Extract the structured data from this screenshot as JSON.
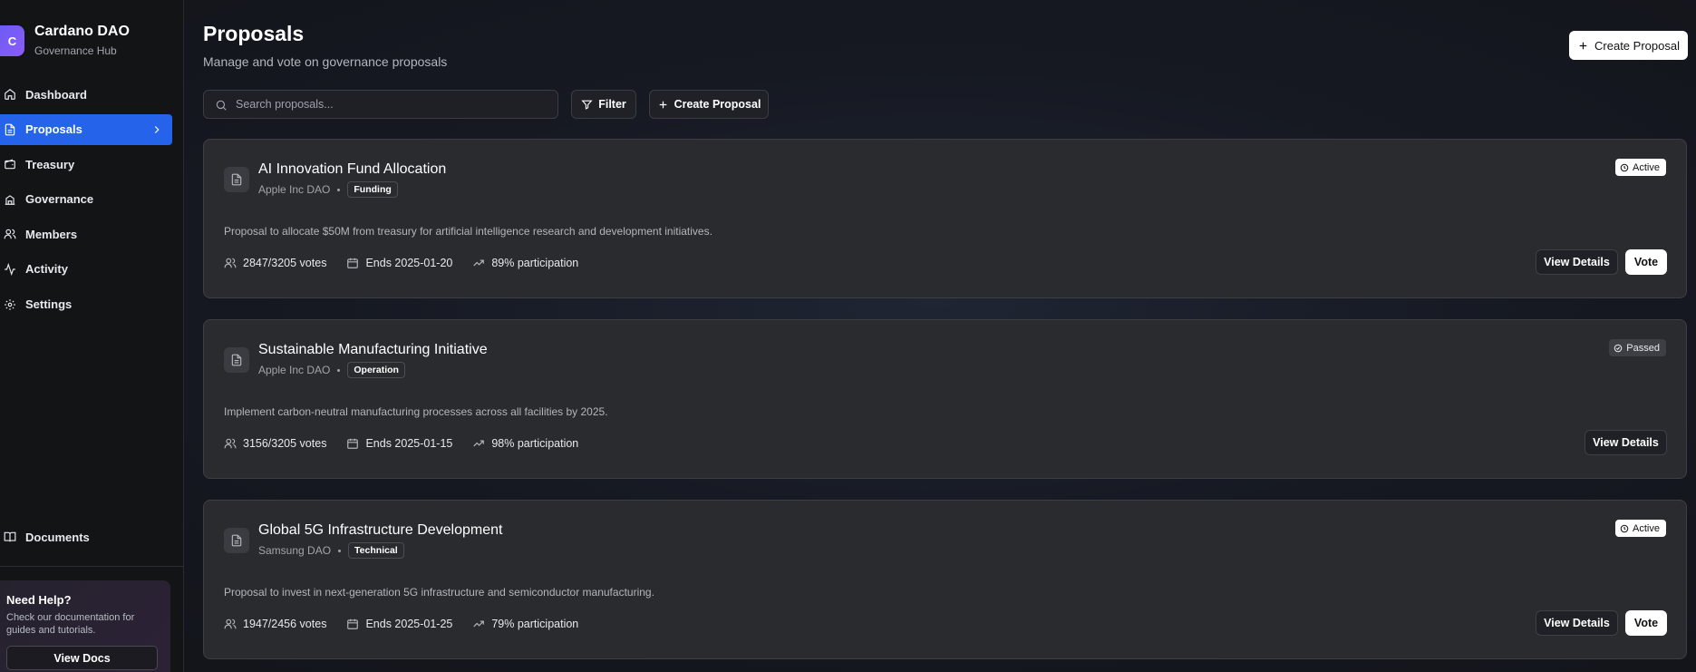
{
  "brand": {
    "logo_letter": "C",
    "title": "Cardano DAO",
    "subtitle": "Governance Hub"
  },
  "sidebar": {
    "items": [
      {
        "label": "Dashboard",
        "icon": "home-icon"
      },
      {
        "label": "Proposals",
        "icon": "file-icon",
        "active": true
      },
      {
        "label": "Treasury",
        "icon": "wallet-icon"
      },
      {
        "label": "Governance",
        "icon": "landmark-icon"
      },
      {
        "label": "Members",
        "icon": "users-icon"
      },
      {
        "label": "Activity",
        "icon": "activity-icon"
      },
      {
        "label": "Settings",
        "icon": "gear-icon"
      }
    ],
    "docs_label": "Documents",
    "help": {
      "title": "Need Help?",
      "text": "Check our documentation for guides and tutorials.",
      "button": "View Docs"
    }
  },
  "header": {
    "title": "Proposals",
    "subtitle": "Manage and vote on governance proposals",
    "create_button": "Create Proposal"
  },
  "toolbar": {
    "search_placeholder": "Search proposals...",
    "filter_label": "Filter",
    "create_label": "Create Proposal"
  },
  "proposals": [
    {
      "title": "AI Innovation Fund Allocation",
      "org": "Apple Inc DAO",
      "tag": "Funding",
      "status": "Active",
      "description": "Proposal to allocate $50M from treasury for artificial intelligence research and development initiatives.",
      "votes": "2847/3205 votes",
      "ends": "Ends 2025-01-20",
      "participation": "89% participation",
      "view_label": "View Details",
      "vote_label": "Vote"
    },
    {
      "title": "Sustainable Manufacturing Initiative",
      "org": "Apple Inc DAO",
      "tag": "Operation",
      "status": "Passed",
      "description": "Implement carbon-neutral manufacturing processes across all facilities by 2025.",
      "votes": "3156/3205 votes",
      "ends": "Ends 2025-01-15",
      "participation": "98% participation",
      "view_label": "View Details"
    },
    {
      "title": "Global 5G Infrastructure Development",
      "org": "Samsung DAO",
      "tag": "Technical",
      "status": "Active",
      "description": "Proposal to invest in next-generation 5G infrastructure and semiconductor manufacturing.",
      "votes": "1947/2456 votes",
      "ends": "Ends 2025-01-25",
      "participation": "79% participation",
      "view_label": "View Details",
      "vote_label": "Vote"
    }
  ],
  "colors": {
    "accent": "#2563eb",
    "brand": "#7c5cf5"
  }
}
